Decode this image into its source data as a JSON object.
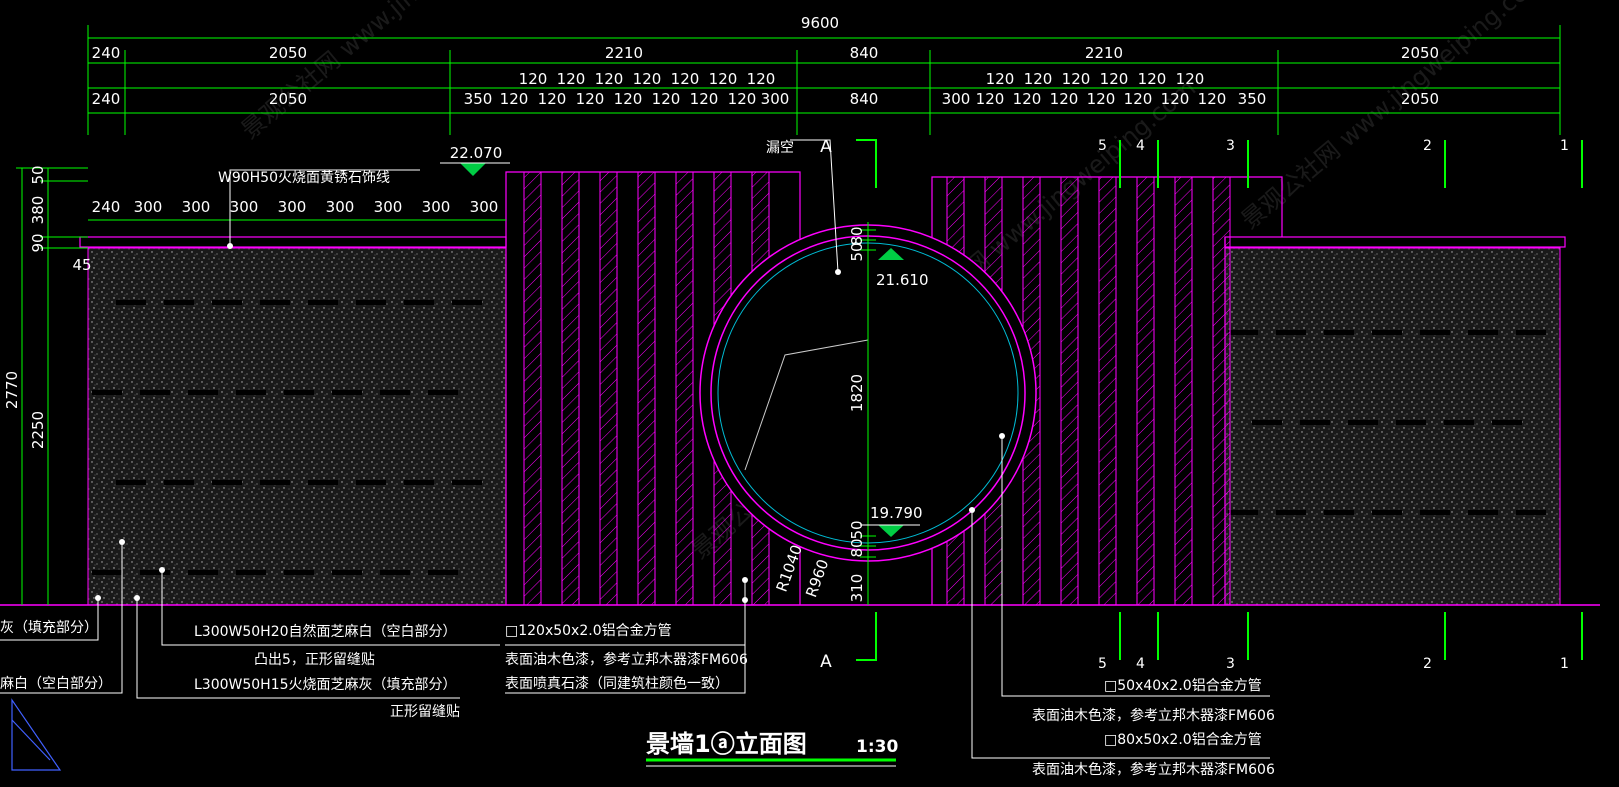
{
  "title": {
    "main": "景墙1ⓐ立面图",
    "scale": "1:30"
  },
  "dimensions": {
    "total": "9600",
    "top_row": [
      "240",
      "2050",
      "2210",
      "840",
      "2210",
      "2050"
    ],
    "sub_row_left": [
      "120",
      "120",
      "120",
      "120",
      "120",
      "120",
      "120"
    ],
    "sub_row_right": [
      "120",
      "120",
      "120",
      "120",
      "120",
      "120"
    ],
    "bottom_row_left": [
      "240",
      "2050",
      "350",
      "120",
      "120",
      "120",
      "120",
      "120",
      "120",
      "120",
      "120",
      "300",
      "840"
    ],
    "bottom_row_right": [
      "300",
      "120",
      "120",
      "120",
      "120",
      "120",
      "120",
      "120",
      "120",
      "120",
      "350",
      "2050"
    ],
    "coping_row": [
      "240",
      "300",
      "300",
      "300",
      "300",
      "300",
      "300",
      "300",
      "300"
    ],
    "left_vertical": [
      "50",
      "380",
      "90",
      "45",
      "2250",
      "2770"
    ],
    "circle_vertical": [
      "80",
      "50",
      "1820",
      "50",
      "80",
      "310"
    ],
    "radius": [
      "R1040",
      "R960"
    ]
  },
  "elevations": {
    "top": "22.070",
    "circle_top": "21.610",
    "circle_bottom": "19.790"
  },
  "section_marks": {
    "left": "A",
    "right": "A"
  },
  "grid_labels_top": [
    "5",
    "4",
    "3",
    "2",
    "1"
  ],
  "grid_labels_bottom": [
    "5",
    "4",
    "3",
    "2",
    "1"
  ],
  "annotations": {
    "coping": "W90H50火烧面黄锈石饰线",
    "hollow": "漏空",
    "left1": "灰（填充部分）",
    "left2": "麻白（空白部分）",
    "mid1": "L300W50H20自然面芝麻白（空白部分）",
    "mid2": "凸出5，正形留缝贴",
    "mid3": "L300W50H15火烧面芝麻灰（填充部分）",
    "mid4": "正形留缝贴",
    "pipe1": "□120x50x2.0铝合金方管",
    "pipe1b": "表面油木色漆，参考立邦木器漆FM606",
    "pipe1c": "表面喷真石漆（同建筑柱颜色一致）",
    "pipe2": "□50x40x2.0铝合金方管",
    "pipe2b": "表面油木色漆，参考立邦木器漆FM606",
    "pipe3": "□80x50x2.0铝合金方管",
    "pipe3b": "表面油木色漆，参考立邦木器漆FM606"
  },
  "watermark": [
    "景观公社网 www.jingweiping.com"
  ],
  "colors": {
    "dim": "#00ff00",
    "wall": "#ff00ff",
    "text": "#ffffff",
    "marker": "#00cc44",
    "inner": "#00bcd4"
  }
}
